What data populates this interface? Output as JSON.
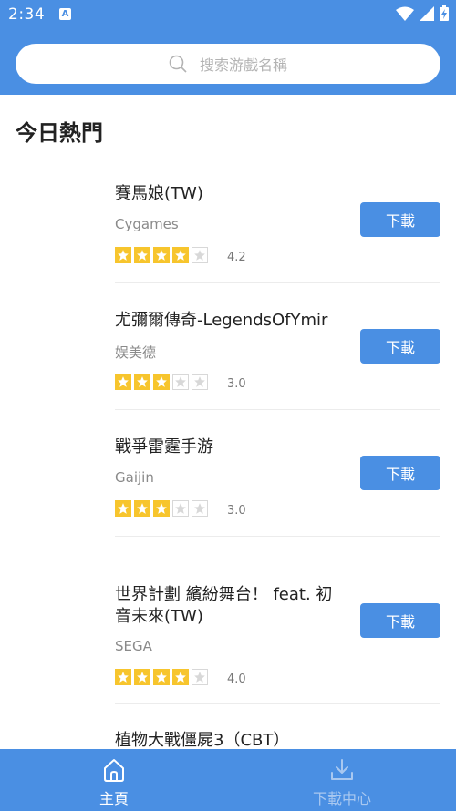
{
  "status_bar": {
    "time": "2:34",
    "badge": "A"
  },
  "search": {
    "placeholder": "搜索游戲名稱",
    "icon": "search-icon"
  },
  "section_title": "今日熱門",
  "games": [
    {
      "name": "賽馬娘(TW)",
      "developer": "Cygames",
      "rating": "4.2",
      "stars": 4,
      "button": "下載"
    },
    {
      "name": "尤彌爾傳奇-LegendsOfYmir",
      "developer": "娱美德",
      "rating": "3.0",
      "stars": 3,
      "button": "下載"
    },
    {
      "name": "戰爭雷霆手游",
      "developer": "Gaijin",
      "rating": "3.0",
      "stars": 3,
      "button": "下載"
    },
    {
      "name": "世界計劃 繽紛舞台！ feat. 初音未來(TW)",
      "developer": "SEGA",
      "rating": "4.0",
      "stars": 4,
      "button": "下載"
    },
    {
      "name": "植物大戰僵屍3（CBT）"
    }
  ],
  "bottom_nav": {
    "home": {
      "label": "主頁",
      "icon": "home-icon"
    },
    "downloads": {
      "label": "下載中心",
      "icon": "download-icon"
    }
  },
  "colors": {
    "primary": "#4a8fe3",
    "star": "#f7c52d"
  }
}
